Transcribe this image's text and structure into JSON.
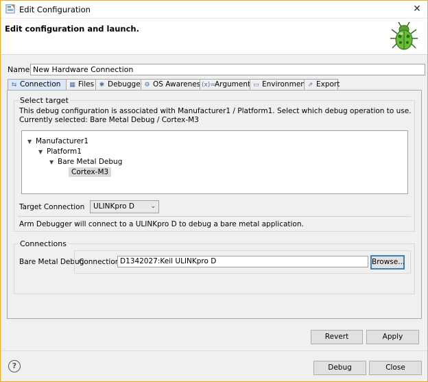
{
  "window": {
    "title": "Edit Configuration",
    "close_symbol": "✕"
  },
  "header": {
    "title": "Edit configuration and launch."
  },
  "name_field": {
    "label": "Name:",
    "value": "New Hardware Connection"
  },
  "tabs": [
    {
      "label": "Connection",
      "icon": "connection-icon",
      "glyph": "⇆"
    },
    {
      "label": "Files",
      "icon": "files-icon",
      "glyph": "▦"
    },
    {
      "label": "Debugger",
      "icon": "debugger-icon",
      "glyph": "✱"
    },
    {
      "label": "OS Awareness",
      "icon": "os-awareness-icon",
      "glyph": "⚙"
    },
    {
      "label": "Arguments",
      "icon": "arguments-icon",
      "glyph": "(x)="
    },
    {
      "label": "Environment",
      "icon": "environment-icon",
      "glyph": "▭"
    },
    {
      "label": "Export",
      "icon": "export-icon",
      "glyph": "⇗"
    }
  ],
  "select_target": {
    "title": "Select target",
    "description1": "This debug configuration is associated with Manufacturer1 / Platform1. Select which debug operation to use.",
    "description2": "Currently selected: Bare Metal Debug / Cortex-M3",
    "tree": [
      {
        "label": "Manufacturer1"
      },
      {
        "label": "Platform1"
      },
      {
        "label": "Bare Metal Debug"
      },
      {
        "label": "Cortex-M3"
      }
    ],
    "tree_arrow": "▼",
    "target_connection_label": "Target Connection",
    "target_connection_value": "ULINKpro D",
    "dropdown_chevron": "⌄",
    "info": "Arm Debugger will connect to a ULINKpro D to debug a bare metal application."
  },
  "connections": {
    "title": "Connections",
    "bare_metal_label": "Bare Metal Debug",
    "connection_label": "Connection",
    "connection_value": "D1342027:Keil ULINKpro D",
    "browse_label": "Browse..."
  },
  "buttons": {
    "revert": "Revert",
    "apply": "Apply",
    "debug": "Debug",
    "close": "Close",
    "help": "?"
  },
  "colors": {
    "window_border": "#f5a623",
    "active_tab": "#dce8f5",
    "focus": "#3c7fb1"
  }
}
